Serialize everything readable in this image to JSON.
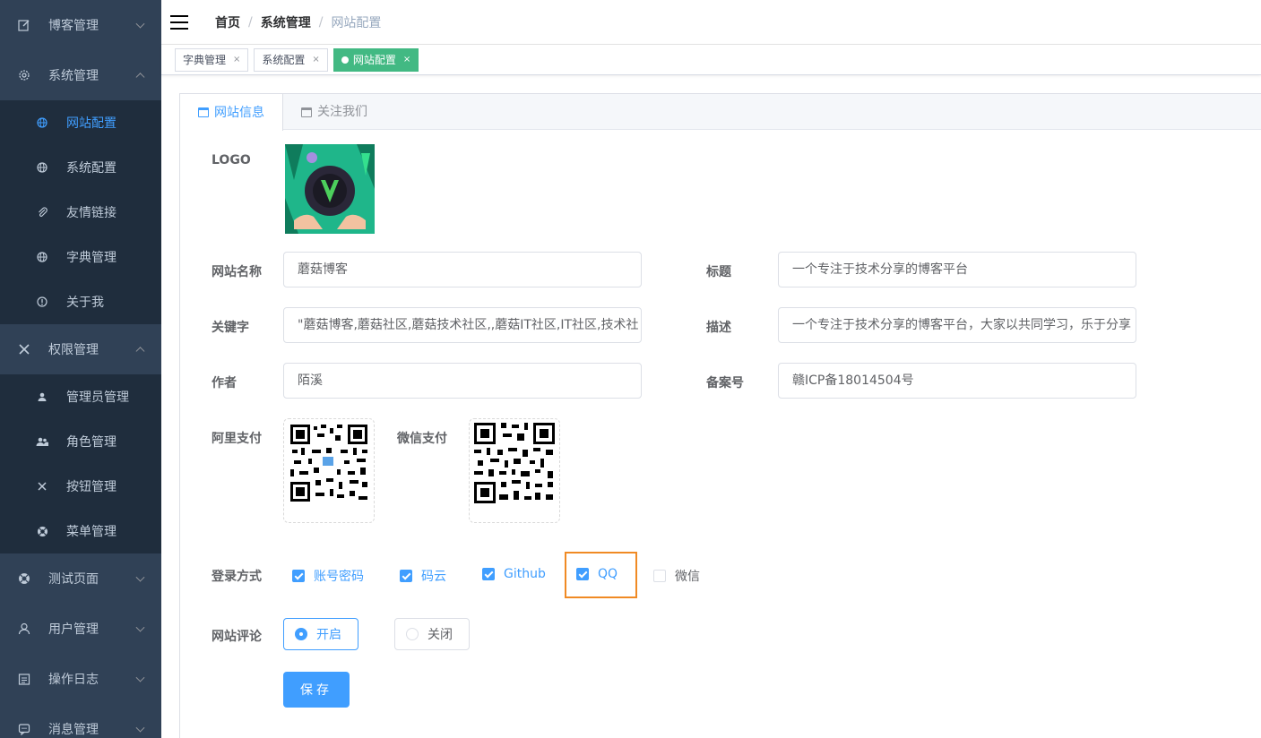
{
  "sidebar": {
    "menus": [
      {
        "label": "博客管理",
        "icon": "edit-icon",
        "expanded": false
      },
      {
        "label": "系统管理",
        "icon": "gear-icon",
        "expanded": true,
        "children": [
          {
            "label": "网站配置",
            "icon": "globe-icon",
            "active": true
          },
          {
            "label": "系统配置",
            "icon": "globe-icon"
          },
          {
            "label": "友情链接",
            "icon": "paperclip-icon"
          },
          {
            "label": "字典管理",
            "icon": "globe-icon"
          },
          {
            "label": "关于我",
            "icon": "info-icon"
          }
        ]
      },
      {
        "label": "权限管理",
        "icon": "tools-icon",
        "expanded": true,
        "children": [
          {
            "label": "管理员管理",
            "icon": "user-icon"
          },
          {
            "label": "角色管理",
            "icon": "users-icon"
          },
          {
            "label": "按钮管理",
            "icon": "tools-icon"
          },
          {
            "label": "菜单管理",
            "icon": "lifebuoy-icon"
          }
        ]
      },
      {
        "label": "测试页面",
        "icon": "lifebuoy-icon",
        "expanded": false
      },
      {
        "label": "用户管理",
        "icon": "person-icon",
        "expanded": false
      },
      {
        "label": "操作日志",
        "icon": "calendar-icon",
        "expanded": false
      },
      {
        "label": "消息管理",
        "icon": "message-icon",
        "expanded": false
      }
    ]
  },
  "breadcrumb": [
    "首页",
    "系统管理",
    "网站配置"
  ],
  "tags": [
    {
      "label": "字典管理",
      "active": false
    },
    {
      "label": "系统配置",
      "active": false
    },
    {
      "label": "网站配置",
      "active": true
    }
  ],
  "tabs": [
    {
      "label": "网站信息",
      "active": true
    },
    {
      "label": "关注我们",
      "active": false
    }
  ],
  "form": {
    "logo_label": "LOGO",
    "name_label": "网站名称",
    "name_value": "蘑菇博客",
    "title_label": "标题",
    "title_value": "一个专注于技术分享的博客平台",
    "keywords_label": "关键字",
    "keywords_value": "\"蘑菇博客,蘑菇社区,蘑菇技术社区,,蘑菇IT社区,IT社区,技术社",
    "desc_label": "描述",
    "desc_value": "一个专注于技术分享的博客平台，大家以共同学习，乐于分享",
    "author_label": "作者",
    "author_value": "陌溪",
    "record_label": "备案号",
    "record_value": "赣ICP备18014504号",
    "alipay_label": "阿里支付",
    "wechatpay_label": "微信支付",
    "login_label": "登录方式",
    "login_options": [
      {
        "label": "账号密码",
        "checked": true
      },
      {
        "label": "码云",
        "checked": true
      },
      {
        "label": "Github",
        "checked": true
      },
      {
        "label": "QQ",
        "checked": true
      },
      {
        "label": "微信",
        "checked": false
      }
    ],
    "comment_label": "网站评论",
    "comment_options": [
      {
        "label": "开启",
        "selected": true
      },
      {
        "label": "关闭",
        "selected": false
      }
    ],
    "save_label": "保存"
  },
  "colors": {
    "sidebar_bg": "#304156",
    "submenu_bg": "#1f2d3d",
    "primary": "#409eff",
    "tag_active": "#42b983",
    "highlight": "#f08a24"
  }
}
